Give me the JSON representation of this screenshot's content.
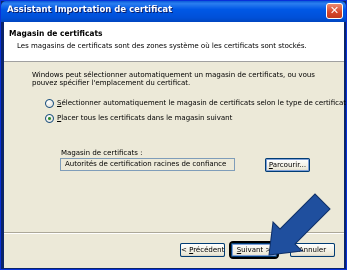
{
  "window": {
    "title": "Assistant Importation de certificat",
    "close_icon": "close-icon"
  },
  "header": {
    "title": "Magasin de certificats",
    "subtitle": "Les magasins de certificats sont des zones système où les certificats sont stockés."
  },
  "main": {
    "description": "Windows peut sélectionner automatiquement un magasin de certificats, ou vous pouvez spécifier l'emplacement du certificat.",
    "options": [
      {
        "label": "Sélectionner automatiquement le magasin de certificats selon le type de certificat",
        "selected": false
      },
      {
        "label": "Placer tous les certificats dans le magasin suivant",
        "selected": true
      }
    ],
    "store_label": "Magasin de certificats :",
    "store_value": "Autorités de certification racines de confiance",
    "browse_label": "Parcourir..."
  },
  "footer": {
    "prev_label": "< Précédent",
    "next_label": "Suivant >",
    "cancel_label": "Annuler"
  },
  "colors": {
    "titlebar": "#0058e6",
    "panel": "#ece9d8",
    "arrow": "#1f4f9e"
  }
}
